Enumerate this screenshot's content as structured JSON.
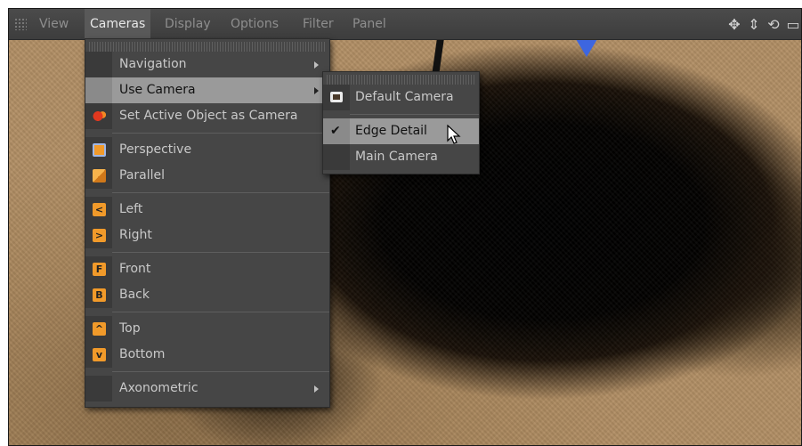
{
  "menubar": {
    "items": [
      {
        "label": "View"
      },
      {
        "label": "Cameras"
      },
      {
        "label": "Display"
      },
      {
        "label": "Options"
      },
      {
        "label": "Filter"
      },
      {
        "label": "Panel"
      }
    ],
    "active": "Cameras",
    "tools": [
      "move-view-icon",
      "pan-vertical-icon",
      "rotate-view-icon",
      "maximize-icon"
    ]
  },
  "cameras_menu": {
    "items": [
      {
        "label": "Navigation",
        "submenu": true
      },
      {
        "label": "Use Camera",
        "submenu": true,
        "highlighted": true
      },
      {
        "label": "Set Active Object as Camera",
        "icon": "camera-object-icon"
      },
      {
        "label": "Perspective",
        "icon": "perspective-icon"
      },
      {
        "label": "Parallel",
        "icon": "parallel-icon"
      },
      {
        "label": "Left",
        "icon": "left-view-icon",
        "icon_glyph": "<"
      },
      {
        "label": "Right",
        "icon": "right-view-icon",
        "icon_glyph": ">"
      },
      {
        "label": "Front",
        "icon": "front-view-icon",
        "icon_glyph": "F"
      },
      {
        "label": "Back",
        "icon": "back-view-icon",
        "icon_glyph": "B"
      },
      {
        "label": "Top",
        "icon": "top-view-icon",
        "icon_glyph": "^"
      },
      {
        "label": "Bottom",
        "icon": "bottom-view-icon",
        "icon_glyph": "v"
      },
      {
        "label": "Axonometric",
        "submenu": true
      }
    ]
  },
  "use_camera_submenu": {
    "items": [
      {
        "label": "Default Camera",
        "icon": "default-camera-icon"
      },
      {
        "label": "Edge Detail",
        "checked": true,
        "highlighted": true
      },
      {
        "label": "Main Camera"
      }
    ],
    "check_glyph": "✔"
  },
  "colors": {
    "menubar": "#3d3d3d",
    "menu_bg": "#464646",
    "highlight": "#9a9a9a",
    "icon_orange": "#f19a2a",
    "marker_blue": "#3d66e0"
  }
}
